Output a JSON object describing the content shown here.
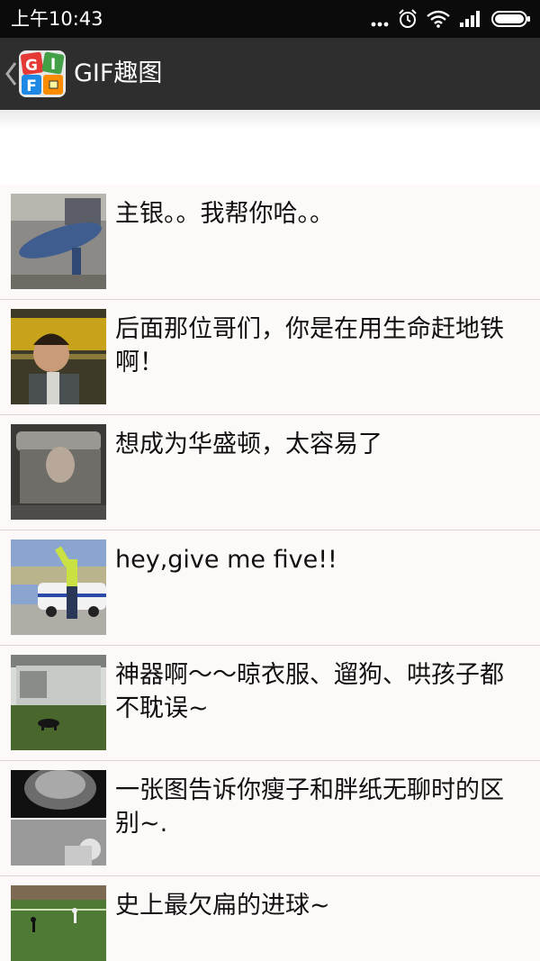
{
  "status_bar": {
    "time": "上午10:43",
    "icons": [
      "more-dots-icon",
      "alarm-icon",
      "wifi-icon",
      "signal-icon",
      "battery-icon"
    ]
  },
  "action_bar": {
    "title": "GIF趣图",
    "logo_letters": [
      "G",
      "I",
      "F"
    ],
    "colors": {
      "background": "#2e2e2e",
      "title": "#ffffff"
    }
  },
  "list": {
    "background": "#fdf9f8",
    "items": [
      {
        "text": "主银。。我帮你哈。。"
      },
      {
        "text": "后面那位哥们，你是在用生命赶地铁啊！"
      },
      {
        "text": "想成为华盛顿，太容易了"
      },
      {
        "text": "hey,give me five!!"
      },
      {
        "text": "神器啊～～晾衣服、遛狗、哄孩子都不耽误~"
      },
      {
        "text": "一张图告诉你瘦子和胖纸无聊时的区别~."
      },
      {
        "text": "史上最欠扁的进球~"
      }
    ]
  }
}
